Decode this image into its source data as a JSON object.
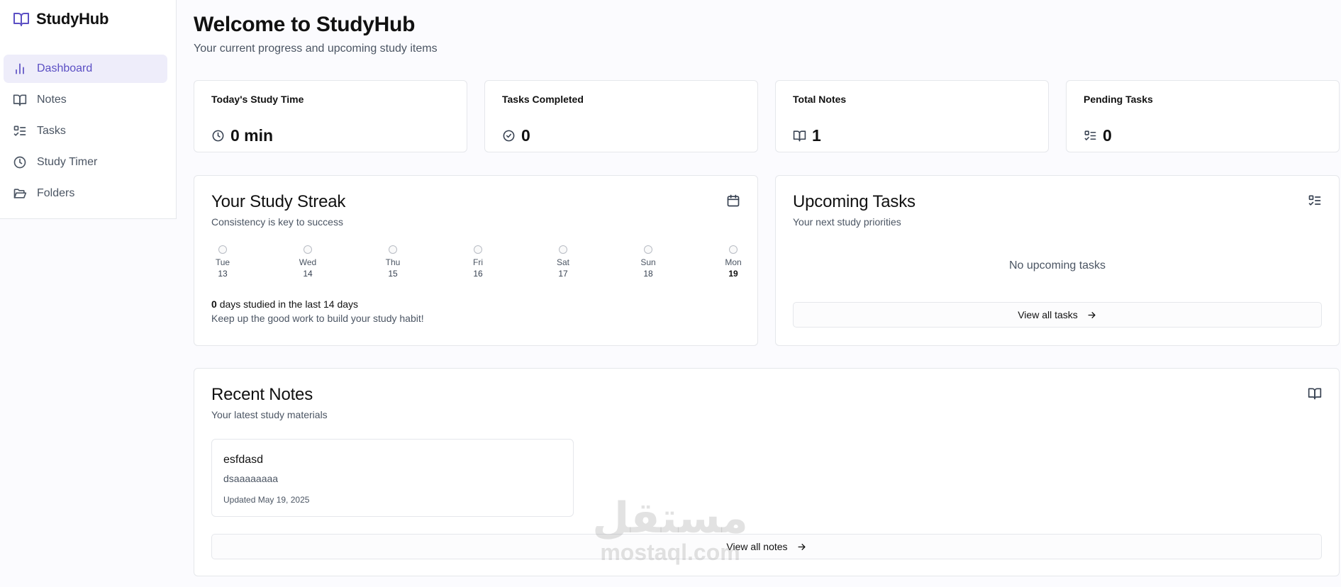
{
  "app": {
    "name": "StudyHub",
    "accent": "#5b4fc4"
  },
  "sidebar": {
    "items": [
      {
        "label": "Dashboard",
        "icon": "bar-chart-icon",
        "active": true
      },
      {
        "label": "Notes",
        "icon": "book-icon",
        "active": false
      },
      {
        "label": "Tasks",
        "icon": "list-checks-icon",
        "active": false
      },
      {
        "label": "Study Timer",
        "icon": "clock-icon",
        "active": false
      },
      {
        "label": "Folders",
        "icon": "folder-open-icon",
        "active": false
      }
    ]
  },
  "header": {
    "title": "Welcome to StudyHub",
    "subtitle": "Your current progress and upcoming study items"
  },
  "stats": [
    {
      "label": "Today's Study Time",
      "value": "0 min",
      "icon": "clock-icon"
    },
    {
      "label": "Tasks Completed",
      "value": "0",
      "icon": "check-circle-icon"
    },
    {
      "label": "Total Notes",
      "value": "1",
      "icon": "book-icon"
    },
    {
      "label": "Pending Tasks",
      "value": "0",
      "icon": "list-checks-icon"
    }
  ],
  "streak": {
    "title": "Your Study Streak",
    "subtitle": "Consistency is key to success",
    "days": [
      {
        "name": "Tue",
        "num": "13"
      },
      {
        "name": "Wed",
        "num": "14"
      },
      {
        "name": "Thu",
        "num": "15"
      },
      {
        "name": "Fri",
        "num": "16"
      },
      {
        "name": "Sat",
        "num": "17"
      },
      {
        "name": "Sun",
        "num": "18"
      },
      {
        "name": "Mon",
        "num": "19"
      }
    ],
    "count": "0",
    "count_text": "days studied in the last 14 days",
    "encouragement": "Keep up the good work to build your study habit!"
  },
  "upcoming": {
    "title": "Upcoming Tasks",
    "subtitle": "Your next study priorities",
    "empty": "No upcoming tasks",
    "button": "View all tasks"
  },
  "recent_notes": {
    "title": "Recent Notes",
    "subtitle": "Your latest study materials",
    "notes": [
      {
        "title": "esfdasd",
        "body": "dsaaaaaaaa",
        "updated": "Updated May 19, 2025"
      }
    ],
    "button": "View all notes"
  },
  "watermark": {
    "arabic": "مستقل",
    "latin": "mostaql.com"
  }
}
